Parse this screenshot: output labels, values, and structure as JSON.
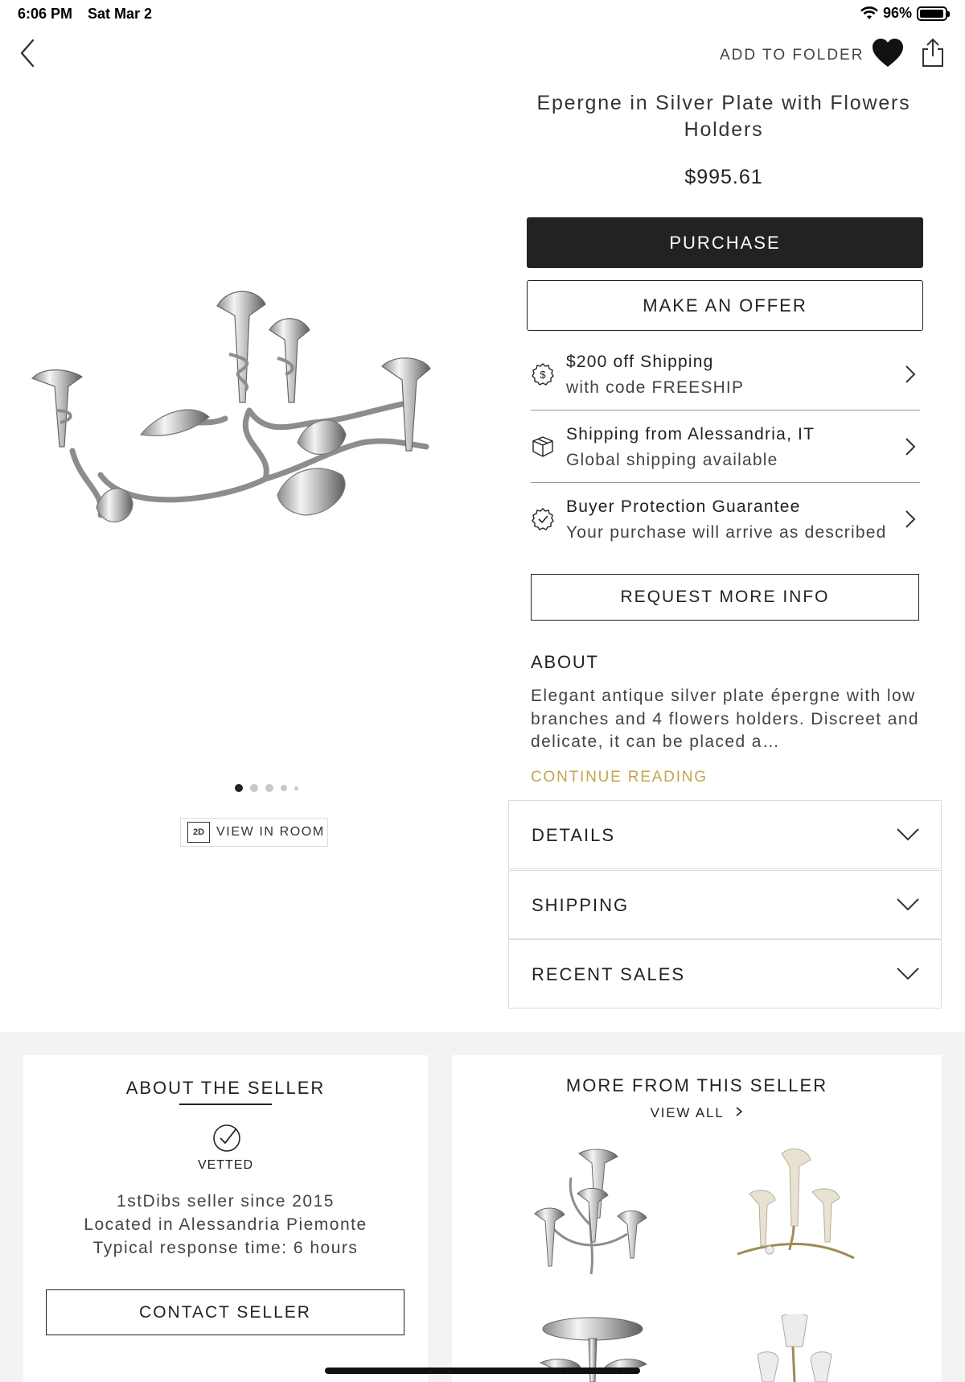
{
  "status_bar": {
    "time": "6:06 PM",
    "date": "Sat Mar 2",
    "battery": "96%"
  },
  "nav": {
    "add_to_folder": "ADD TO FOLDER"
  },
  "product": {
    "title": "Epergne in Silver Plate with Flowers Holders",
    "price": "$995.61",
    "purchase_label": "PURCHASE",
    "offer_label": "MAKE AN OFFER",
    "image_index": 1,
    "image_count": 5,
    "view_in_room_badge": "2D",
    "view_in_room_label": "VIEW IN ROOM"
  },
  "info_rows": [
    {
      "icon": "dollar-icon",
      "title": "$200 off Shipping",
      "subtitle": "with code FREESHIP"
    },
    {
      "icon": "box-icon",
      "title": "Shipping from Alessandria, IT",
      "subtitle": "Global shipping available"
    },
    {
      "icon": "check-badge-icon",
      "title": "Buyer Protection Guarantee",
      "subtitle": "Your purchase will arrive as described"
    }
  ],
  "request_info_label": "REQUEST MORE INFO",
  "about": {
    "heading": "ABOUT",
    "body": "Elegant antique silver plate épergne with low branches and 4 flowers holders. Discreet and delicate, it can be placed a…",
    "continue_label": "CONTINUE READING"
  },
  "accordions": [
    {
      "label": "DETAILS"
    },
    {
      "label": "SHIPPING"
    },
    {
      "label": "RECENT SALES"
    }
  ],
  "seller": {
    "heading": "ABOUT THE SELLER",
    "vetted_label": "VETTED",
    "since": "1stDibs seller since 2015",
    "location": "Located in Alessandria Piemonte",
    "response": "Typical response time: 6 hours",
    "contact_label": "CONTACT SELLER"
  },
  "more_from_seller": {
    "heading": "MORE FROM THIS SELLER",
    "view_all_label": "VIEW ALL"
  },
  "colors": {
    "accent_gold": "#c2a64a",
    "button_dark": "#222222",
    "band_gray": "#f3f3f3"
  }
}
